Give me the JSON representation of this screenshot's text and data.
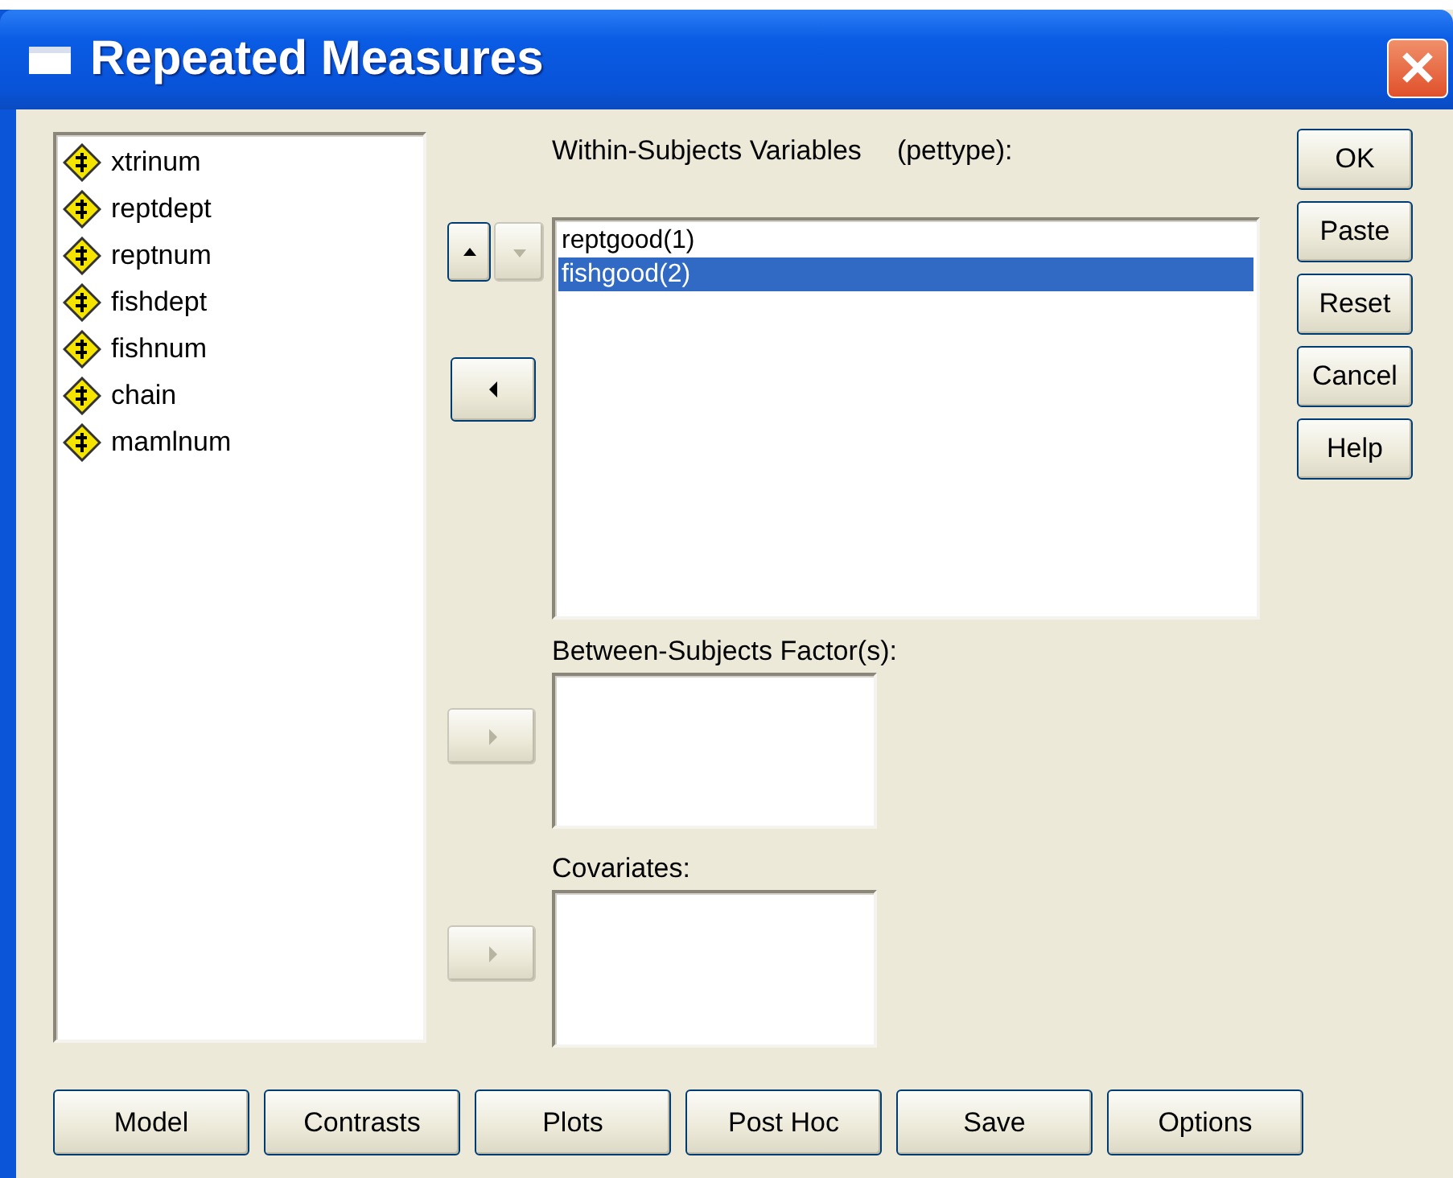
{
  "window": {
    "title": "Repeated Measures"
  },
  "source_variables": [
    {
      "name": "xtrinum",
      "selected": false
    },
    {
      "name": "reptdept",
      "selected": false
    },
    {
      "name": "reptnum",
      "selected": false
    },
    {
      "name": "fishdept",
      "selected": false
    },
    {
      "name": "fishnum",
      "selected": false
    },
    {
      "name": "chain",
      "selected": false
    },
    {
      "name": "mamlnum",
      "selected": false
    }
  ],
  "within_subjects": {
    "label": "Within-Subjects Variables",
    "factor": "(pettype):",
    "order_buttons": [
      {
        "kind": "up",
        "disabled": false
      },
      {
        "kind": "down",
        "disabled": true
      }
    ],
    "transfer_button": {
      "kind": "left",
      "disabled": false
    },
    "items": [
      {
        "name": "reptgood(1)",
        "selected": false
      },
      {
        "name": "fishgood(2)",
        "selected": true
      }
    ]
  },
  "between_subjects": {
    "label": "Between-Subjects Factor(s):",
    "transfer_button": {
      "kind": "right",
      "disabled": true
    }
  },
  "covariates": {
    "label": "Covariates:",
    "transfer_button": {
      "kind": "right",
      "disabled": true
    }
  },
  "side_buttons": [
    {
      "label": "OK"
    },
    {
      "label": "Paste"
    },
    {
      "label": "Reset"
    },
    {
      "label": "Cancel"
    },
    {
      "label": "Help"
    }
  ],
  "bottom_buttons": [
    {
      "label": "Model"
    },
    {
      "label": "Contrasts"
    },
    {
      "label": "Plots"
    },
    {
      "label": "Post Hoc"
    },
    {
      "label": "Save"
    },
    {
      "label": "Options"
    }
  ]
}
